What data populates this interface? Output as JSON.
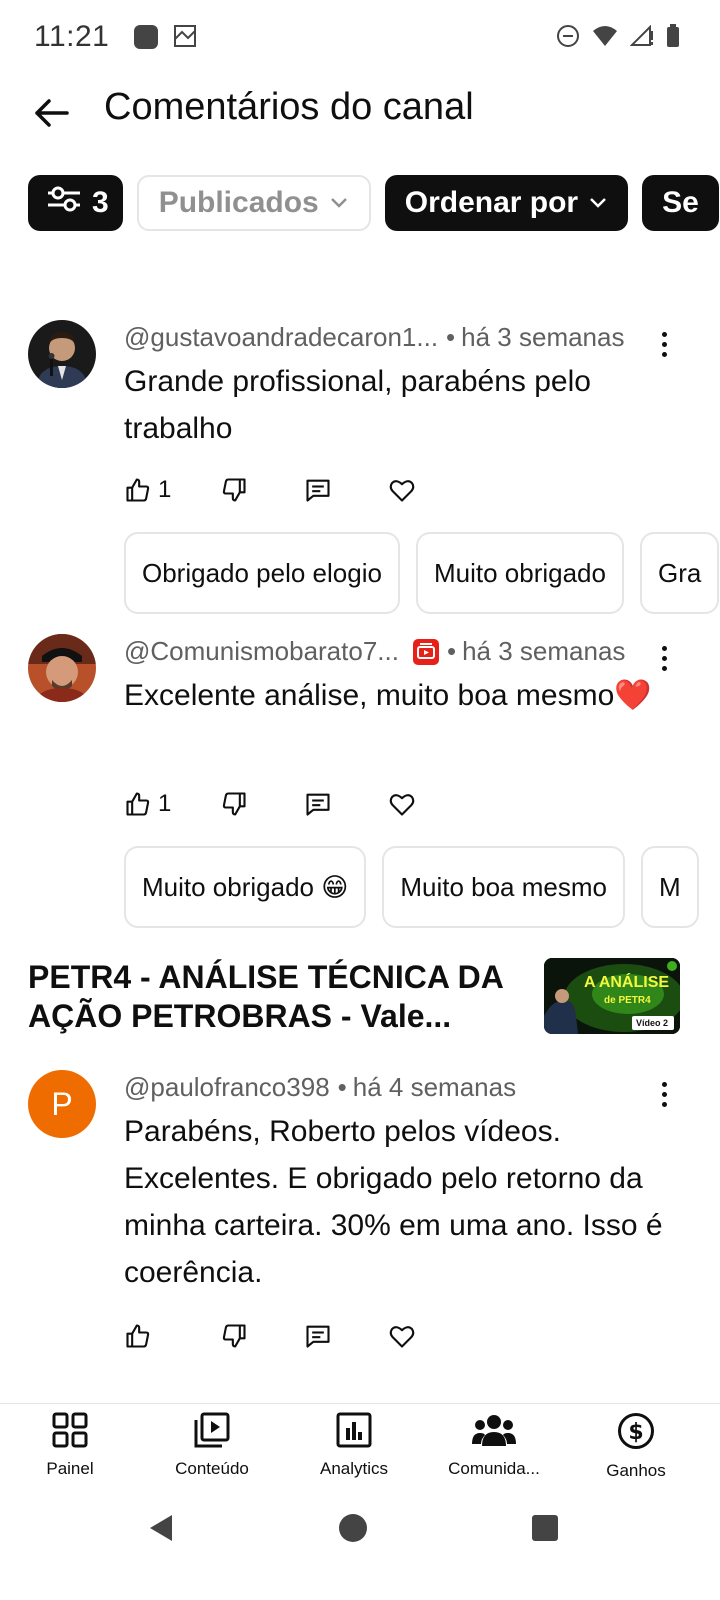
{
  "status": {
    "time": "11:21"
  },
  "header": {
    "title": "Comentários do canal"
  },
  "filters": {
    "count": "3",
    "published_label": "Publicados",
    "sort_label": "Ordenar por",
    "next_chip_partial": "Se"
  },
  "comments": [
    {
      "author": "@gustavoandradecaron1...",
      "time": "há 3 semanas",
      "text": "Grande profissional, parabéns pelo trabalho",
      "likes": "1",
      "suggestions": [
        "Obrigado pelo elogio",
        "Muito obrigado",
        "Gra"
      ]
    },
    {
      "author": "@Comunismobarato7...",
      "time": "há 3 semanas",
      "text": "Excelente  análise,  muito boa mesmo❤️",
      "likes": "1",
      "suggestions": [
        "Muito obrigado 😁",
        "Muito boa mesmo",
        "M"
      ]
    },
    {
      "author": "@paulofranco398",
      "time": "há 4 semanas",
      "text": "Parabéns, Roberto pelos vídeos. Excelentes. E obrigado pelo retorno da minha carteira. 30% em uma ano. Isso é coerência.",
      "avatar_letter": "P",
      "avatar_color": "#ef6c00"
    }
  ],
  "video": {
    "title": "PETR4 - ANÁLISE TÉCNICA DA AÇÃO PETROBRAS - Vale...",
    "thumb_line1": "A ANÁLISE",
    "thumb_line2": "de PETR4",
    "thumb_tag": "Vídeo 2"
  },
  "nav": {
    "items": [
      "Painel",
      "Conteúdo",
      "Analytics",
      "Comunida...",
      "Ganhos"
    ]
  },
  "colors": {
    "accent_dark": "#0f0f0f",
    "secondary_text": "#606060",
    "youtube_red": "#e62117"
  }
}
